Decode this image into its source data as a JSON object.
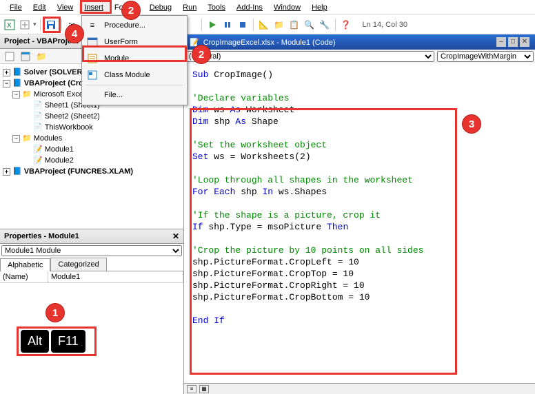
{
  "menu": {
    "file": "File",
    "edit": "Edit",
    "view": "View",
    "insert": "Insert",
    "format": "Format",
    "debug": "Debug",
    "run": "Run",
    "tools": "Tools",
    "addins": "Add-Ins",
    "window": "Window",
    "help": "Help"
  },
  "toolbar": {
    "status": "Ln 14, Col 30"
  },
  "dropdown": {
    "procedure": "Procedure...",
    "userform": "UserForm",
    "module": "Module",
    "classmodule": "Class Module",
    "file": "File..."
  },
  "project": {
    "title": "Project - VBAProject",
    "tree": {
      "solver": "Solver (SOLVER.XLAM)",
      "vba1": "VBAProject (CropImageExcel.xlsx)",
      "meo": "Microsoft Excel Objects",
      "sheet1": "Sheet1 (Sheet1)",
      "sheet2": "Sheet2 (Sheet2)",
      "twb": "ThisWorkbook",
      "modules": "Modules",
      "mod1": "Module1",
      "mod2": "Module2",
      "vba2": "VBAProject (FUNCRES.XLAM)"
    }
  },
  "properties": {
    "title": "Properties - Module1",
    "selector": "Module1 Module",
    "tabs": {
      "a": "Alphabetic",
      "c": "Categorized"
    },
    "name_lbl": "(Name)",
    "name_val": "Module1"
  },
  "code": {
    "title": "CropImageExcel.xlsx - Module1 (Code)",
    "dd1": "(General)",
    "dd2": "CropImageWithMargin",
    "l1a": "Sub",
    "l1b": " CropImage()",
    "l2": "'Declare variables",
    "l3a": "Dim",
    "l3b": " ws ",
    "l3c": "As",
    "l3d": " Worksheet",
    "l4a": "Dim",
    "l4b": " shp ",
    "l4c": "As",
    "l4d": " Shape",
    "l5": "'Set the worksheet object",
    "l6a": "Set",
    "l6b": " ws = Worksheets(2)",
    "l7": "'Loop through all shapes in the worksheet",
    "l8a": "For Each",
    "l8b": " shp ",
    "l8c": "In",
    "l8d": " ws.Shapes",
    "l9": "'If the shape is a picture, crop it",
    "l10a": "If",
    "l10b": " shp.Type = msoPicture ",
    "l10c": "Then",
    "l11": "'Crop the picture by 10 points on all sides",
    "l12": "shp.PictureFormat.CropLeft = 10",
    "l13": "shp.PictureFormat.CropTop = 10",
    "l14": "shp.PictureFormat.CropRight = 10",
    "l15": "shp.PictureFormat.CropBottom = 10",
    "l16": "End If"
  },
  "ann": {
    "k1": "Alt",
    "k2": "F11",
    "n1": "1",
    "n2": "2",
    "n2b": "2",
    "n3": "3",
    "n4": "4"
  }
}
